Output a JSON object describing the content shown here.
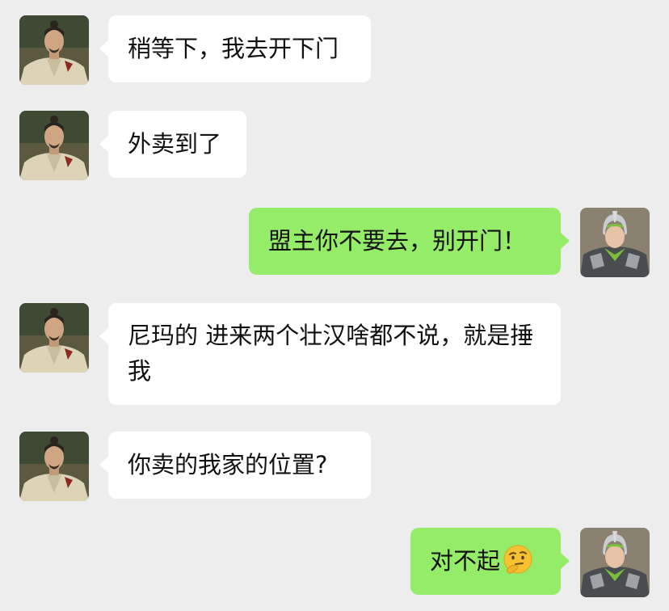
{
  "messages": [
    {
      "side": "left",
      "sender_avatar": "scholar-avatar",
      "text": "稍等下，我去开下门"
    },
    {
      "side": "left",
      "sender_avatar": "scholar-avatar",
      "text": "外卖到了"
    },
    {
      "side": "right",
      "sender_avatar": "warrior-avatar",
      "text": "盟主你不要去，别开门！"
    },
    {
      "side": "left",
      "sender_avatar": "scholar-avatar",
      "text": "尼玛的  进来两个壮汉啥都不说，就是捶我"
    },
    {
      "side": "left",
      "sender_avatar": "scholar-avatar",
      "text": "你卖的我家的位置?"
    },
    {
      "side": "right",
      "sender_avatar": "warrior-avatar",
      "text": "对不起",
      "emoji": "thinking-face-emoji"
    }
  ],
  "colors": {
    "background": "#ededed",
    "incoming_bubble": "#ffffff",
    "outgoing_bubble": "#95ec69",
    "text": "#111111"
  }
}
